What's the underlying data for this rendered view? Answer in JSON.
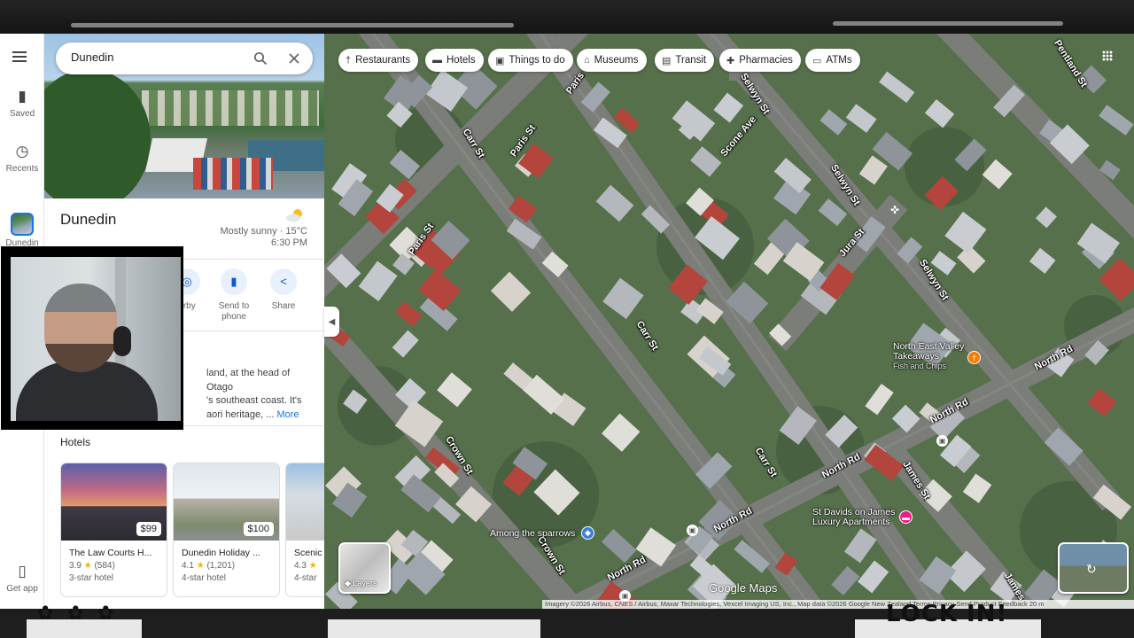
{
  "nav": {
    "saved": "Saved",
    "recents": "Recents",
    "dunedin": "Dunedin",
    "get_app": "Get app"
  },
  "search": {
    "value": "Dunedin"
  },
  "place": {
    "title": "Dunedin",
    "weather": "Mostly sunny · 15°C",
    "time": "6:30 PM"
  },
  "actions": {
    "nearby": "arby",
    "send_to_phone": "Send to phone",
    "share": "Share"
  },
  "description": {
    "line1": "land, at the head of Otago",
    "line2": "'s southeast coast. It's",
    "line3": "aori heritage, ...",
    "more": "More"
  },
  "hotels": {
    "heading": "Hotels",
    "items": [
      {
        "name": "The Law Courts H...",
        "rating": "3.9",
        "reviews": "(584)",
        "class": "3-star hotel",
        "price": "$99"
      },
      {
        "name": "Dunedin Holiday ...",
        "rating": "4.1",
        "reviews": "(1,201)",
        "class": "4-star hotel",
        "price": "$100"
      },
      {
        "name": "Scenic",
        "rating": "4.3",
        "reviews": "",
        "class": "4-star",
        "price": ""
      }
    ]
  },
  "chips": [
    "Restaurants",
    "Hotels",
    "Things to do",
    "Museums",
    "Transit",
    "Pharmacies",
    "ATMs"
  ],
  "map": {
    "streets": {
      "carr1": "Carr St",
      "carr2": "Carr St",
      "carr3": "Carr St",
      "paris1": "Paris St",
      "paris2": "Paris St",
      "paris3": "Paris",
      "selwyn1": "Selwyn St",
      "selwyn2": "Selwyn St",
      "selwyn3": "Selwyn St",
      "scone": "Scone Ave",
      "jura": "Jura St",
      "pentland": "Pentland St",
      "north1": "North Rd",
      "north2": "North Rd",
      "north3": "North Rd",
      "north4": "North Rd",
      "north5": "North Rd",
      "crown1": "Crown St",
      "crown2": "Crown St",
      "james1": "James St",
      "james2": "James"
    },
    "pois": {
      "takeaways_line1": "North East Valley",
      "takeaways_line2": "Takeaways",
      "takeaways_sub": "Fish and Chips",
      "stdavids_line1": "St Davids on James",
      "stdavids_line2": "Luxury Apartments",
      "sparrows": "Among the sparrows"
    },
    "layers": "Layers",
    "google": "Google Maps",
    "attribution": "Imagery ©2026 Airbus, CNES / Airbus, Maxar Technologies, Vexcel Imaging US, Inc., Map data ©2026 Google    New Zealand    Terms    Privacy    Send Product Feedback    20 m"
  },
  "overlay": {
    "decor_left": "✿ ✿ ✿",
    "lock_in": "LOCK IN!"
  },
  "colors": {
    "accent": "#1a73e8",
    "star": "#f4b400",
    "poi_food": "#f57c00",
    "poi_hotel": "#e91e8a"
  }
}
